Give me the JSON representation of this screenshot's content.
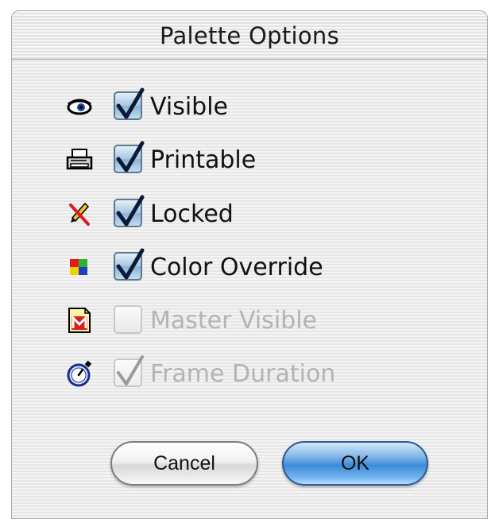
{
  "dialog": {
    "title": "Palette Options"
  },
  "options": [
    {
      "label": "Visible",
      "checked": true,
      "enabled": true,
      "icon": "eye-icon"
    },
    {
      "label": "Printable",
      "checked": true,
      "enabled": true,
      "icon": "printer-icon"
    },
    {
      "label": "Locked",
      "checked": true,
      "enabled": true,
      "icon": "crossed-pencil-icon"
    },
    {
      "label": "Color Override",
      "checked": true,
      "enabled": true,
      "icon": "color-squares-icon"
    },
    {
      "label": "Master Visible",
      "checked": false,
      "enabled": false,
      "icon": "master-page-icon"
    },
    {
      "label": "Frame Duration",
      "checked": true,
      "enabled": false,
      "icon": "stopwatch-icon"
    }
  ],
  "buttons": {
    "cancel": "Cancel",
    "ok": "OK"
  },
  "colors": {
    "checkbox_blue": "#8cb2d4",
    "ok_blue": "#3d8bd9",
    "disabled_text": "#b3b3b3"
  }
}
